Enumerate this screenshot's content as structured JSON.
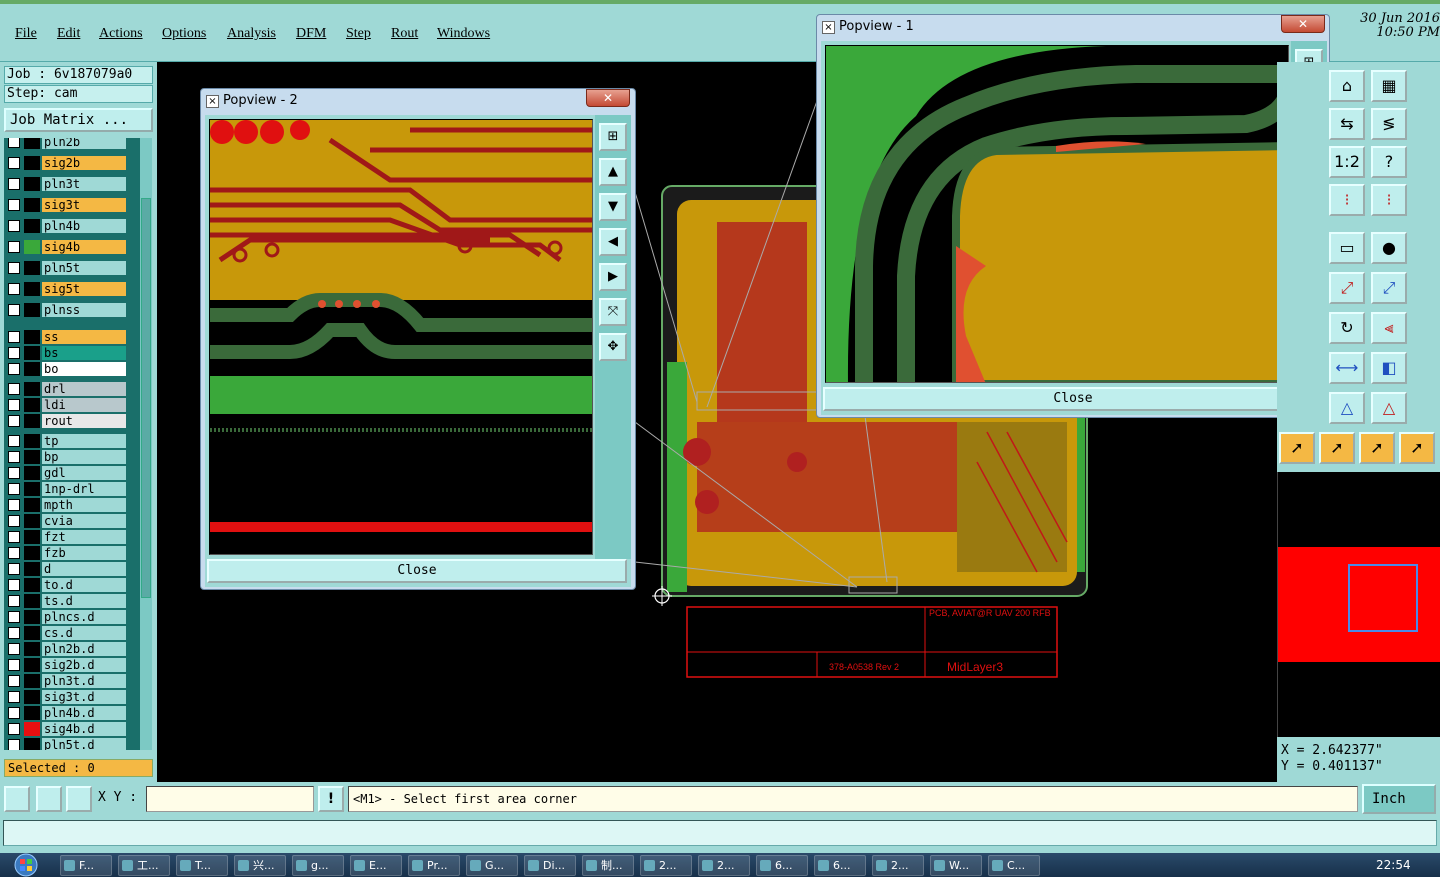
{
  "menu": [
    "File",
    "Edit",
    "Actions",
    "Options",
    "Analysis",
    "DFM",
    "Step",
    "Rout",
    "Windows"
  ],
  "datetime": {
    "date": "30 Jun 2016",
    "time": "10:50 PM"
  },
  "job": {
    "job_label": "Job : 6v187079a0",
    "step_label": "Step: cam",
    "matrix_button": "Job Matrix ..."
  },
  "layers": [
    {
      "name": "pln2b",
      "color": "#9fd9d6",
      "swatch": "#000000"
    },
    {
      "name": "sig2b",
      "color": "#f4b844",
      "swatch": "#000000"
    },
    {
      "name": "pln3t",
      "color": "#9fd9d6",
      "swatch": "#000000"
    },
    {
      "name": "sig3t",
      "color": "#f4b844",
      "swatch": "#000000"
    },
    {
      "name": "pln4b",
      "color": "#9fd9d6",
      "swatch": "#000000"
    },
    {
      "name": "sig4b",
      "color": "#f4b844",
      "swatch": "#3aa83a"
    },
    {
      "name": "pln5t",
      "color": "#9fd9d6",
      "swatch": "#000000"
    },
    {
      "name": "sig5t",
      "color": "#f4b844",
      "swatch": "#000000"
    },
    {
      "name": "plnss",
      "color": "#9fd9d6",
      "swatch": "#000000"
    },
    {
      "name": "ss",
      "color": "#f4b844",
      "swatch": "#000000"
    },
    {
      "name": "bs",
      "color": "#1aa08a",
      "swatch": "#000000"
    },
    {
      "name": "bo",
      "color": "#ffffff",
      "swatch": "#000000"
    },
    {
      "name": "drl",
      "color": "#b8c8cc",
      "swatch": "#000000"
    },
    {
      "name": "ldi",
      "color": "#b8c8cc",
      "swatch": "#000000"
    },
    {
      "name": "rout",
      "color": "#e8e8e8",
      "swatch": "#000000"
    },
    {
      "name": "tp",
      "color": "#9fd9d6",
      "swatch": "#000000"
    },
    {
      "name": "bp",
      "color": "#9fd9d6",
      "swatch": "#000000"
    },
    {
      "name": "gdl",
      "color": "#9fd9d6",
      "swatch": "#000000"
    },
    {
      "name": "1np-drl",
      "color": "#9fd9d6",
      "swatch": "#000000"
    },
    {
      "name": "mpth",
      "color": "#9fd9d6",
      "swatch": "#000000"
    },
    {
      "name": "cvia",
      "color": "#9fd9d6",
      "swatch": "#000000"
    },
    {
      "name": "fzt",
      "color": "#9fd9d6",
      "swatch": "#000000"
    },
    {
      "name": "fzb",
      "color": "#9fd9d6",
      "swatch": "#000000"
    },
    {
      "name": "d",
      "color": "#9fd9d6",
      "swatch": "#000000"
    },
    {
      "name": "to.d",
      "color": "#9fd9d6",
      "swatch": "#000000"
    },
    {
      "name": "ts.d",
      "color": "#9fd9d6",
      "swatch": "#000000"
    },
    {
      "name": "plncs.d",
      "color": "#9fd9d6",
      "swatch": "#000000"
    },
    {
      "name": "cs.d",
      "color": "#9fd9d6",
      "swatch": "#000000"
    },
    {
      "name": "pln2b.d",
      "color": "#9fd9d6",
      "swatch": "#000000"
    },
    {
      "name": "sig2b.d",
      "color": "#9fd9d6",
      "swatch": "#000000"
    },
    {
      "name": "pln3t.d",
      "color": "#9fd9d6",
      "swatch": "#000000"
    },
    {
      "name": "sig3t.d",
      "color": "#9fd9d6",
      "swatch": "#000000"
    },
    {
      "name": "pln4b.d",
      "color": "#9fd9d6",
      "swatch": "#000000"
    },
    {
      "name": "sig4b.d",
      "color": "#9fd9d6",
      "swatch": "#e81010"
    },
    {
      "name": "pln5t.d",
      "color": "#9fd9d6",
      "swatch": "#000000"
    }
  ],
  "selected_label": "Selected : 0",
  "popview2": {
    "title": "Popview - 2",
    "close": "Close"
  },
  "popview1": {
    "title": "Popview - 1",
    "close": "Close"
  },
  "titleblock": {
    "company": "PCB, AVIAT@R UAV 200 RFB",
    "partno": "378-A0538 Rev 2",
    "layer": "MidLayer3"
  },
  "coords": {
    "x": "X = 2.642377\"",
    "y": "Y = 0.401137\""
  },
  "command": {
    "xy_label": "X Y :",
    "xy_value": "",
    "prompt": "<M1> - Select first area corner",
    "unit": "Inch"
  },
  "taskbar": {
    "clock": "22:54",
    "tasks": [
      "F...",
      "工...",
      "T...",
      "兴...",
      "g...",
      "E...",
      "Pr...",
      "G...",
      "Di...",
      "制...",
      "2...",
      "2...",
      "6...",
      "6...",
      "2...",
      "W...",
      "C..."
    ]
  },
  "colors": {
    "panel": "#9fd9d6",
    "copper": "#c8980a",
    "board_green": "#3aa83a",
    "trace_red": "#c01818"
  }
}
